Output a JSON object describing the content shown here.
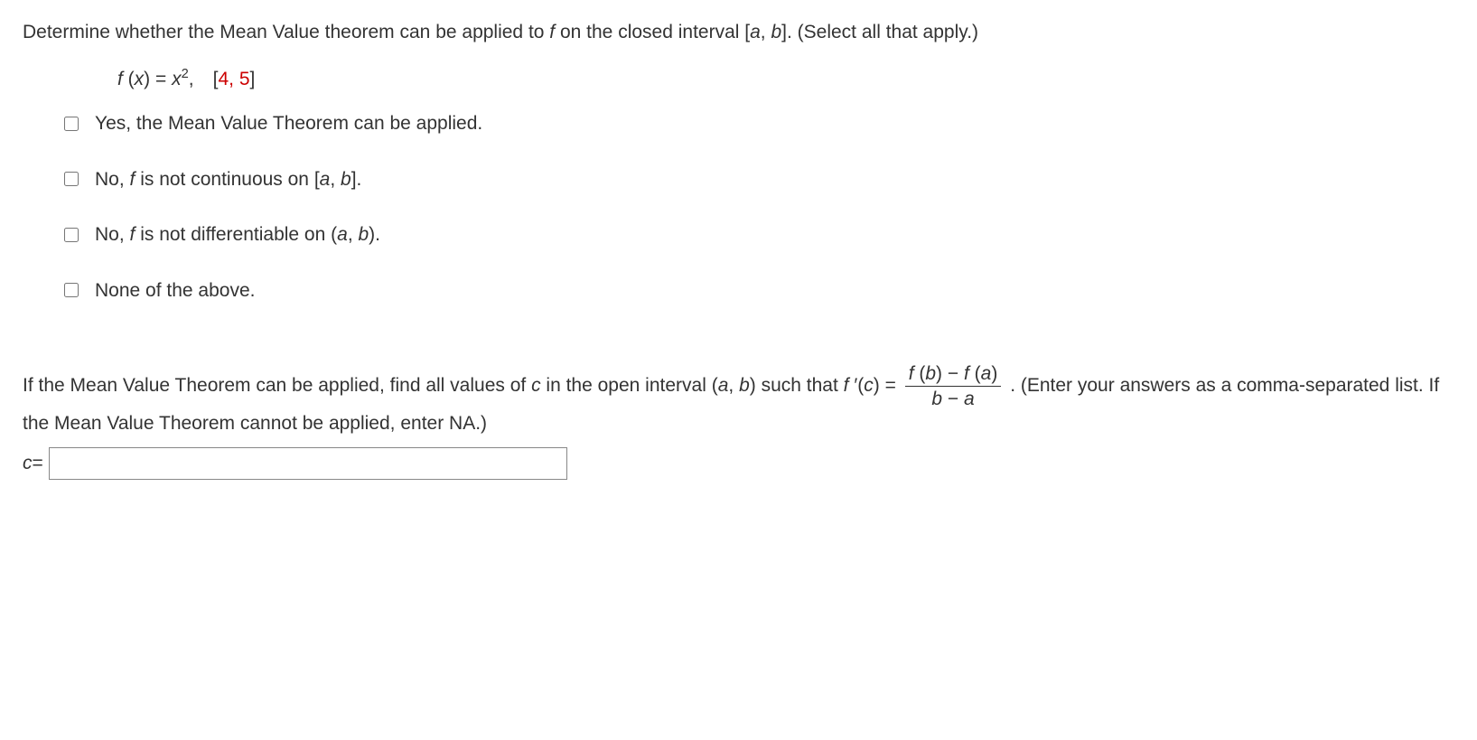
{
  "question": {
    "prompt_part1": "Determine whether the Mean Value theorem can be applied to ",
    "prompt_f": "f",
    "prompt_part2": " on the closed interval [",
    "prompt_a": "a",
    "prompt_comma": ", ",
    "prompt_b": "b",
    "prompt_part3": "]. (Select all that apply.)"
  },
  "function_def": {
    "f_prefix": "f ",
    "f_paren_open": "(",
    "f_var": "x",
    "f_paren_close": ") = ",
    "f_base": "x",
    "f_exp": "2",
    "f_interval_sep": ", [",
    "interval_a": "4",
    "interval_comma": ", ",
    "interval_b": "5",
    "interval_close": "]"
  },
  "options": {
    "opt1": "Yes, the Mean Value Theorem can be applied.",
    "opt2_pre": "No, ",
    "opt2_f": "f",
    "opt2_mid": " is not continuous on [",
    "opt2_a": "a",
    "opt2_c": ", ",
    "opt2_b": "b",
    "opt2_end": "].",
    "opt3_pre": "No, ",
    "opt3_f": "f",
    "opt3_mid": " is not differentiable on (",
    "opt3_a": "a",
    "opt3_c": ", ",
    "opt3_b": "b",
    "opt3_end": ").",
    "opt4": "None of the above."
  },
  "part2": {
    "p1": "If the Mean Value Theorem can be applied, find all values of ",
    "c": "c",
    "p2": " in the open interval (",
    "a": "a",
    "cm": ", ",
    "b": "b",
    "p3": ") such that ",
    "lhs_f": "f ",
    "lhs_prime": "′(",
    "lhs_c": "c",
    "lhs_close": ") = ",
    "num_f1": "f ",
    "num_po1": "(",
    "num_b": "b",
    "num_pc1": ") − ",
    "num_f2": "f ",
    "num_po2": "(",
    "num_a": "a",
    "num_pc2": ")",
    "den_b": "b",
    "den_minus": " − ",
    "den_a": "a",
    "p4": " . (Enter your answers as a comma-separated list. If the Mean Value Theorem cannot be applied, enter NA.)",
    "answer_label_c": "c",
    "answer_label_eq": " ="
  }
}
